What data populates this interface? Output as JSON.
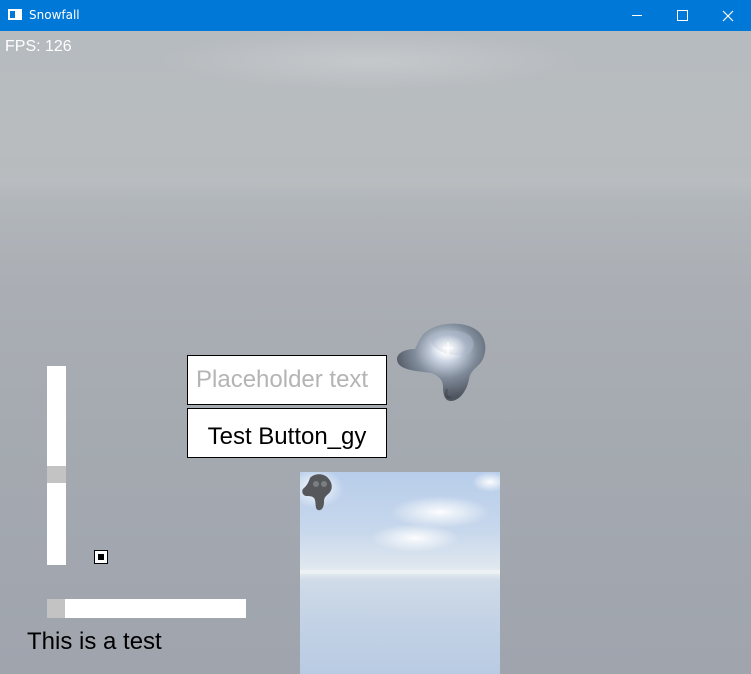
{
  "window": {
    "title": "Snowfall",
    "icons": {
      "app": "app-window-icon",
      "minimize": "minimize-icon",
      "maximize": "maximize-icon",
      "close": "close-icon"
    },
    "accent_color": "#0078d7"
  },
  "hud": {
    "fps_text": "FPS: 126"
  },
  "ui": {
    "textbox": {
      "placeholder": "Placeholder text",
      "value": ""
    },
    "button": {
      "label": "Test Button_gy"
    },
    "label": {
      "text": "This is a test"
    },
    "checkbox": {
      "checked": true
    },
    "vertical_slider": {
      "value": 0.55
    },
    "horizontal_slider": {
      "value": 0.0
    }
  },
  "scene": {
    "objects": [
      "monkey-head-model",
      "sky-cloud-backdrop"
    ],
    "preview": {
      "content": "render-target-preview"
    }
  }
}
